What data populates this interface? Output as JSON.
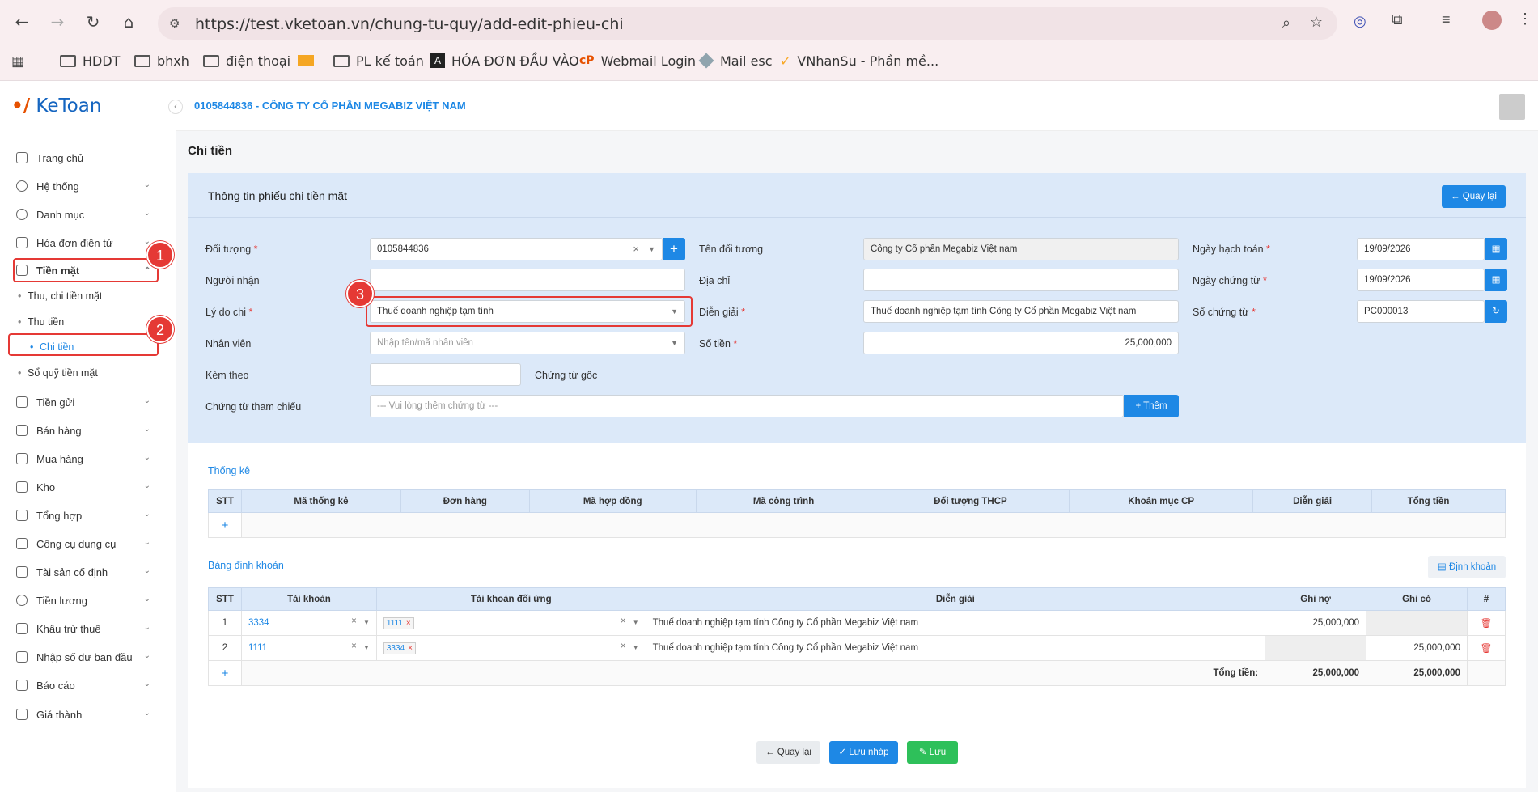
{
  "browser": {
    "url": "https://test.vketoan.vn/chung-tu-quy/add-edit-phieu-chi",
    "bookmarks": [
      "HDDT",
      "bhxh",
      "điện thoại",
      "PL kế toán",
      "HÓA ĐƠN ĐẦU VÀO",
      "Webmail Login",
      "Mail esc",
      "VNhanSu - Phần mề..."
    ]
  },
  "app": {
    "logo": "KeToan",
    "company": "0105844836 - CÔNG TY CỔ PHẦN MEGABIZ VIỆT NAM",
    "page_title": "Chi tiền"
  },
  "sidebar": {
    "items": [
      {
        "label": "Trang chủ"
      },
      {
        "label": "Hệ thống"
      },
      {
        "label": "Danh mục"
      },
      {
        "label": "Hóa đơn điện tử"
      },
      {
        "label": "Tiền mặt"
      },
      {
        "label": "Tiền gửi"
      },
      {
        "label": "Bán hàng"
      },
      {
        "label": "Mua hàng"
      },
      {
        "label": "Kho"
      },
      {
        "label": "Tổng hợp"
      },
      {
        "label": "Công cụ dụng cụ"
      },
      {
        "label": "Tài sản cố định"
      },
      {
        "label": "Tiền lương"
      },
      {
        "label": "Khấu trừ thuế"
      },
      {
        "label": "Nhập số dư ban đầu"
      },
      {
        "label": "Báo cáo"
      },
      {
        "label": "Giá thành"
      }
    ],
    "subitems": [
      "Thu, chi tiền mặt",
      "Thu tiền",
      "Chi tiền",
      "Sổ quỹ tiền mặt"
    ]
  },
  "badges": [
    "1",
    "2",
    "3"
  ],
  "form": {
    "header": "Thông tin phiếu chi tiền mặt",
    "back_label": "Quay lại",
    "doi_tuong_label": "Đối tượng",
    "doi_tuong_value": "0105844836",
    "nguoi_nhan_label": "Người nhận",
    "ly_do_chi_label": "Lý do chi",
    "ly_do_chi_value": "Thuế doanh nghiệp tạm tính",
    "nhan_vien_label": "Nhân viên",
    "nhan_vien_placeholder": "Nhập tên/mã nhân viên",
    "kem_theo_label": "Kèm theo",
    "chung_tu_goc_label": "Chứng từ gốc",
    "chung_tu_tham_chieu_label": "Chứng từ tham chiếu",
    "chung_tu_tham_chieu_placeholder": "--- Vui lòng thêm chứng từ ---",
    "them_label": "Thêm",
    "ten_doi_tuong_label": "Tên đối tượng",
    "ten_doi_tuong_value": "Công ty Cổ phần Megabiz Việt nam",
    "dia_chi_label": "Địa chỉ",
    "dien_giai_label": "Diễn giải",
    "dien_giai_value": "Thuế doanh nghiệp tạm tính Công ty Cổ phần Megabiz Việt nam",
    "so_tien_label": "Số tiền",
    "so_tien_value": "25,000,000",
    "ngay_hach_toan_label": "Ngày hạch toán",
    "ngay_hach_toan_value": "19/09/2026",
    "ngay_chung_tu_label": "Ngày chứng từ",
    "ngay_chung_tu_value": "19/09/2026",
    "so_chung_tu_label": "Số chứng từ",
    "so_chung_tu_value": "PC000013"
  },
  "thong_ke": {
    "title": "Thống kê",
    "columns": [
      "STT",
      "Mã thống kê",
      "Đơn hàng",
      "Mã hợp đồng",
      "Mã công trình",
      "Đối tượng THCP",
      "Khoản mục CP",
      "Diễn giải",
      "Tổng tiền"
    ]
  },
  "dinh_khoan": {
    "title": "Bảng định khoản",
    "button": "Định khoản",
    "columns": [
      "STT",
      "Tài khoản",
      "Tài khoản đối ứng",
      "Diễn giải",
      "Ghi nợ",
      "Ghi có",
      "#"
    ],
    "rows": [
      {
        "stt": "1",
        "tk": "3334",
        "tkdu": "1111",
        "dien_giai": "Thuế doanh nghiệp tạm tính Công ty Cổ phần Megabiz Việt nam",
        "ghi_no": "25,000,000",
        "ghi_co": ""
      },
      {
        "stt": "2",
        "tk": "1111",
        "tkdu": "3334",
        "dien_giai": "Thuế doanh nghiệp tạm tính Công ty Cổ phần Megabiz Việt nam",
        "ghi_no": "",
        "ghi_co": "25,000,000"
      }
    ],
    "total_label": "Tổng tiền:",
    "total_no": "25,000,000",
    "total_co": "25,000,000"
  },
  "footer": {
    "back": "Quay lại",
    "save_draft": "Lưu nháp",
    "save": "Lưu"
  }
}
